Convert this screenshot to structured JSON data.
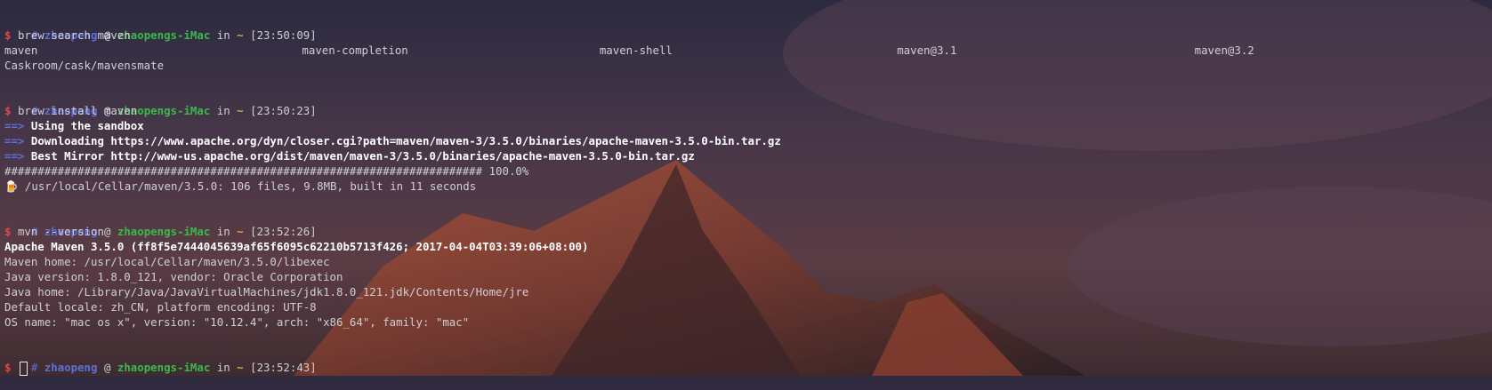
{
  "prompt": {
    "hash": "#",
    "user": "zhaopeng",
    "at": "@",
    "host": "zhaopengs-iMac",
    "in": "in",
    "dir": "~",
    "dollar": "$"
  },
  "blocks": [
    {
      "time": "[23:50:09]",
      "command": "brew search maven",
      "search_results": [
        "maven",
        "maven-completion",
        "maven-shell",
        "maven@3.1",
        "maven@3.2"
      ],
      "extra_line": "Caskroom/cask/mavensmate"
    },
    {
      "time": "[23:50:23]",
      "command": "brew install maven",
      "arrow": "==>",
      "steps": [
        "Using the sandbox",
        "Downloading https://www.apache.org/dyn/closer.cgi?path=maven/maven-3/3.5.0/binaries/apache-maven-3.5.0-bin.tar.gz",
        "Best Mirror http://www-us.apache.org/dist/maven/maven-3/3.5.0/binaries/apache-maven-3.5.0-bin.tar.gz"
      ],
      "progress_bar": "######################################################################## 100.0%",
      "progress": 1.0,
      "beer": "🍺",
      "summary": "/usr/local/Cellar/maven/3.5.0: 106 files, 9.8MB, built in 11 seconds"
    },
    {
      "time": "[23:52:26]",
      "command": "mvn --version",
      "output_bold": "Apache Maven 3.5.0 (ff8f5e7444045639af65f6095c62210b5713f426; 2017-04-04T03:39:06+08:00)",
      "output": [
        "Maven home: /usr/local/Cellar/maven/3.5.0/libexec",
        "Java version: 1.8.0_121, vendor: Oracle Corporation",
        "Java home: /Library/Java/JavaVirtualMachines/jdk1.8.0_121.jdk/Contents/Home/jre",
        "Default locale: zh_CN, platform encoding: UTF-8",
        "OS name: \"mac os x\", version: \"10.12.4\", arch: \"x86_64\", family: \"mac\""
      ]
    },
    {
      "time": "[23:52:43]"
    }
  ],
  "colors": {
    "prompt_user": "#5f6fd8",
    "prompt_host": "#3cb84a",
    "prompt_dir": "#d6b13a",
    "dollar": "#e04848"
  }
}
